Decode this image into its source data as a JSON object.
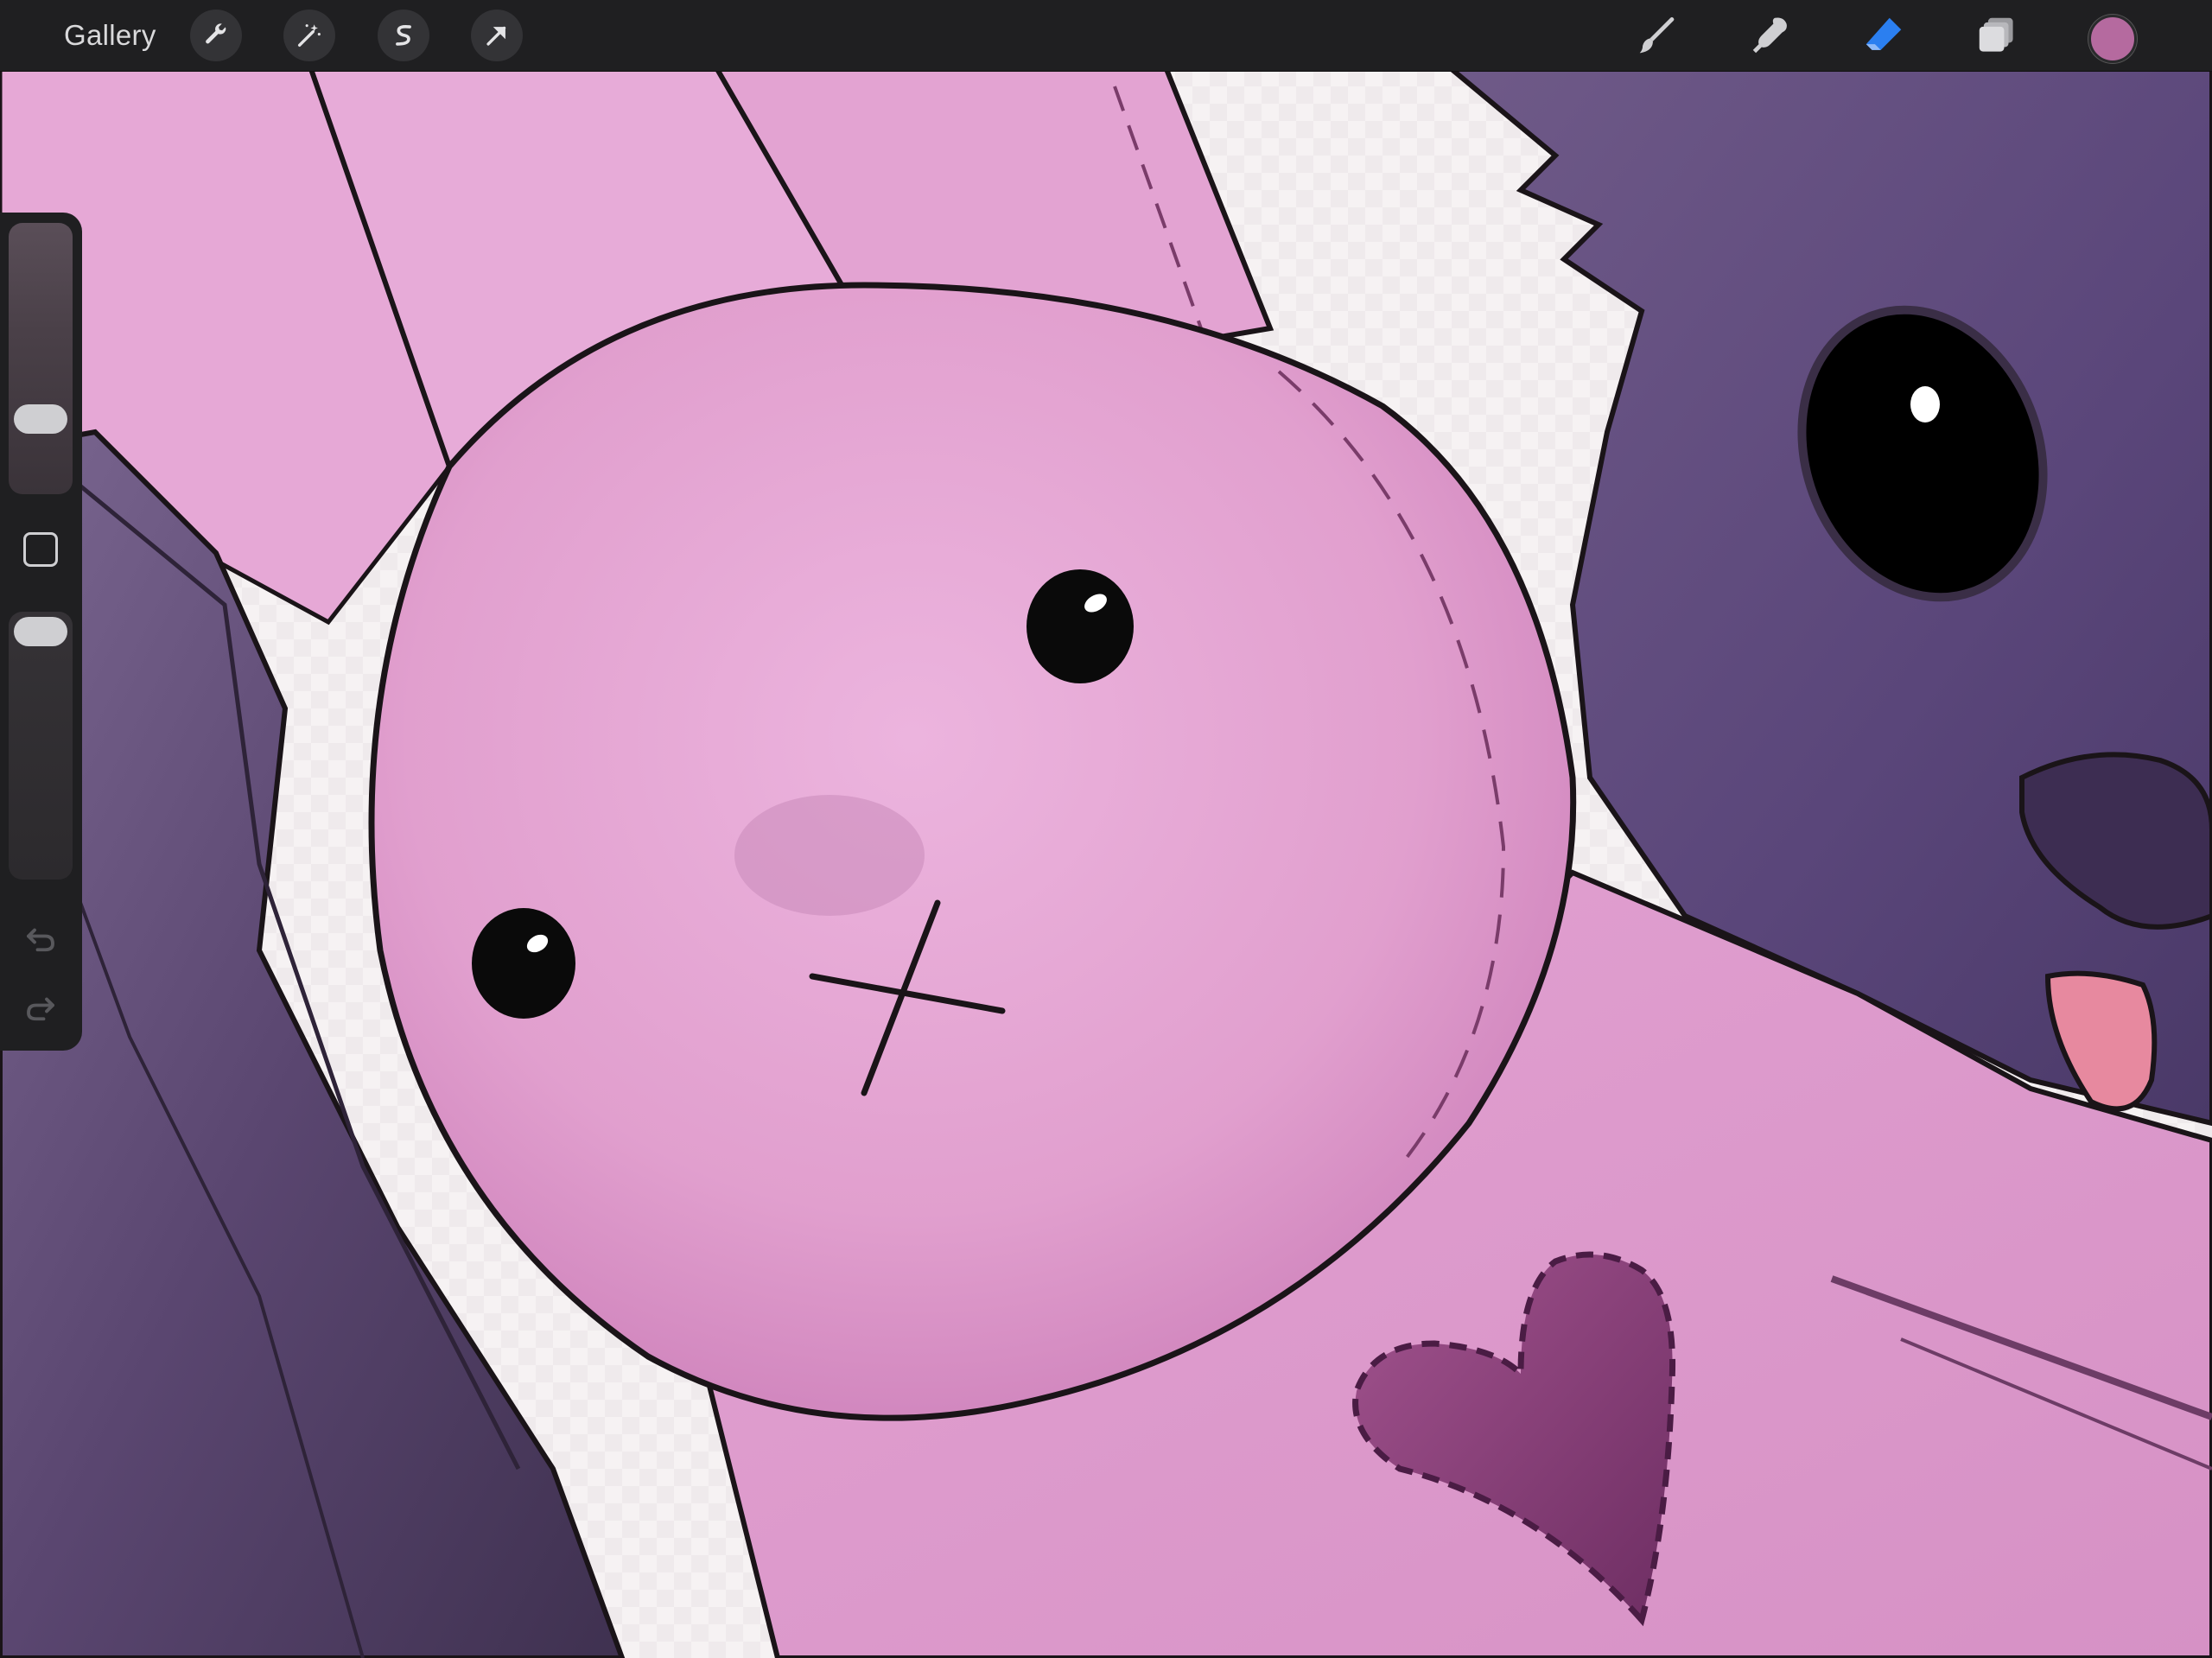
{
  "toolbar": {
    "gallery_label": "Gallery",
    "left_tools": [
      {
        "name": "actions",
        "icon": "wrench-icon"
      },
      {
        "name": "adjustments",
        "icon": "magic-wand-icon"
      },
      {
        "name": "selection",
        "icon": "selection-s-icon"
      },
      {
        "name": "transform",
        "icon": "transform-arrow-icon"
      }
    ],
    "right_tools": [
      {
        "name": "brush",
        "icon": "brush-icon",
        "active": false
      },
      {
        "name": "smudge",
        "icon": "smudge-finger-icon",
        "active": false
      },
      {
        "name": "eraser",
        "icon": "eraser-icon",
        "active": true
      },
      {
        "name": "layers",
        "icon": "layers-icon",
        "active": false
      },
      {
        "name": "colors",
        "icon": "color-swatch-icon",
        "active": false
      }
    ],
    "current_color": "#b56a9f",
    "active_tool_color": "#2b7ff0"
  },
  "sidebar": {
    "brush_size": 0.24,
    "brush_opacity": 1.0,
    "modify_icon": "square-modify-icon",
    "undo_icon": "undo-icon",
    "redo_icon": "redo-icon"
  },
  "canvas": {
    "description_colors": {
      "background": "#f4f0f1",
      "bunny_pink": "#e4a6d3",
      "bunny_shadow": "#c77ab4",
      "dog_purple": "#5f4a78",
      "hair_purple": "#4e3d5f",
      "heart": "#8a3f78",
      "line": "#1a1418"
    }
  }
}
